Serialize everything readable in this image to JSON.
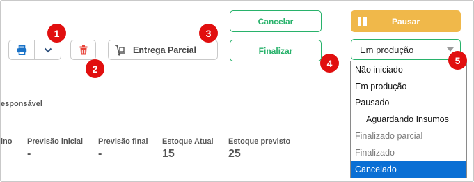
{
  "toolbar": {
    "entrega_label": "Entrega Parcial",
    "cancel_label": "Cancelar",
    "finalize_label": "Finalizar",
    "pause_label": "Pausar"
  },
  "status_select": {
    "selected": "Em produção",
    "options": [
      {
        "label": "Não iniciado"
      },
      {
        "label": "Em produção"
      },
      {
        "label": "Pausado"
      },
      {
        "label": "Aguardando Insumos"
      },
      {
        "label": "Finalizado parcial"
      },
      {
        "label": "Finalizado"
      },
      {
        "label": "Cancelado"
      }
    ]
  },
  "badges": [
    "1",
    "2",
    "3",
    "4",
    "5"
  ],
  "info": {
    "responsavel_label": "esponsável",
    "fields": [
      {
        "label": "ino",
        "value": ""
      },
      {
        "label": "Previsão inicial",
        "value": "-"
      },
      {
        "label": "Previsão final",
        "value": "-"
      },
      {
        "label": "Estoque Atual",
        "value": "15"
      },
      {
        "label": "Estoque previsto",
        "value": "25"
      }
    ]
  },
  "colors": {
    "green": "#28b26b",
    "orange": "#f0b84a",
    "blue_print": "#1a73c8",
    "red_trash": "#e8443a",
    "badge_red": "#e10f0f",
    "selected_bg": "#0a6fd4"
  }
}
